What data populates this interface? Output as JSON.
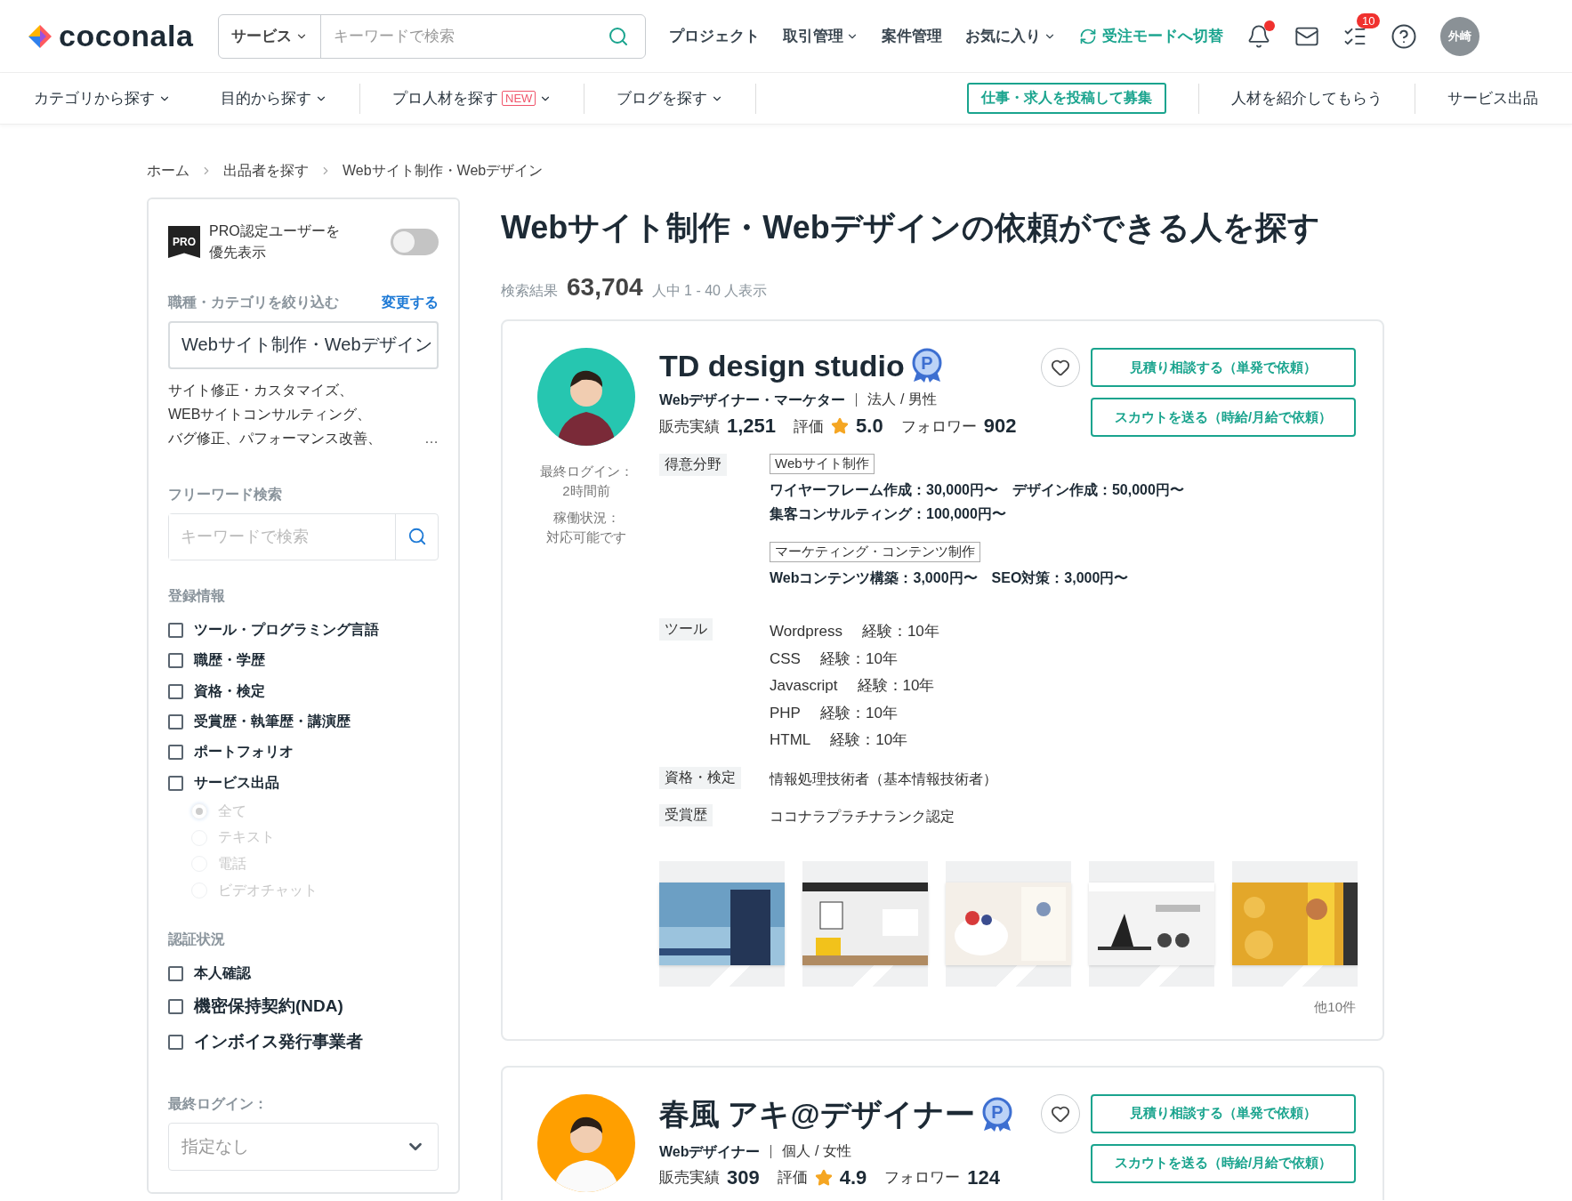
{
  "header": {
    "logo": "coconala",
    "search": {
      "category": "サービス",
      "placeholder": "キーワードで検索"
    },
    "nav": [
      {
        "label": "プロジェクト",
        "dropdown": false
      },
      {
        "label": "取引管理",
        "dropdown": true
      },
      {
        "label": "案件管理",
        "dropdown": false
      },
      {
        "label": "お気に入り",
        "dropdown": true
      }
    ],
    "mode_switch": "受注モードへ切替",
    "notification_dot": true,
    "todo_badge": "10",
    "avatar": "外崎"
  },
  "subnav": [
    {
      "label": "カテゴリから探す",
      "kind": "menu",
      "dropdown": true
    },
    {
      "label": "目的から探す",
      "kind": "menu",
      "dropdown": true
    },
    {
      "label": "プロ人材を探す",
      "kind": "menu",
      "dropdown": true,
      "badge": "NEW"
    },
    {
      "label": "ブログを探す",
      "kind": "menu",
      "dropdown": true
    },
    {
      "label": "仕事・求人を投稿して募集",
      "kind": "outlined",
      "dropdown": false
    },
    {
      "label": "人材を紹介してもらう",
      "kind": "menu",
      "dropdown": false
    },
    {
      "label": "サービス出品",
      "kind": "menu",
      "dropdown": false
    }
  ],
  "breadcrumb": [
    "ホーム",
    "出品者を探す",
    "Webサイト制作・Webデザイン"
  ],
  "sidebar": {
    "pro_toggle": {
      "badge": "PRO",
      "label": "PRO認定ユーザーを優先表示",
      "on": false
    },
    "category": {
      "heading": "職種・カテゴリを絞り込む",
      "change_link": "変更する",
      "value": "Webサイト制作・Webデザイン",
      "subcategories": [
        "サイト修正・カスタマイズ、",
        "WEBサイトコンサルティング、",
        "バグ修正、パフォーマンス改善、"
      ],
      "more": "…"
    },
    "freeword": {
      "heading": "フリーワード検索",
      "placeholder": "キーワードで検索"
    },
    "registration": {
      "heading": "登録情報",
      "options": [
        {
          "label": "ツール・プログラミング言語",
          "checked": false
        },
        {
          "label": "職歴・学歴",
          "checked": false
        },
        {
          "label": "資格・検定",
          "checked": false
        },
        {
          "label": "受賞歴・執筆歴・講演歴",
          "checked": false
        },
        {
          "label": "ポートフォリオ",
          "checked": false
        },
        {
          "label": "サービス出品",
          "checked": false
        }
      ],
      "service_types": {
        "disabled": true,
        "options": [
          {
            "label": "全て",
            "selected": true
          },
          {
            "label": "テキスト",
            "selected": false
          },
          {
            "label": "電話",
            "selected": false
          },
          {
            "label": "ビデオチャット",
            "selected": false
          }
        ]
      }
    },
    "verification": {
      "heading": "認証状況",
      "options": [
        {
          "label": "本人確認",
          "checked": false
        },
        {
          "label": "機密保持契約(NDA)",
          "checked": false
        },
        {
          "label": "インボイス発行事業者",
          "checked": false
        }
      ]
    },
    "last_login": {
      "heading": "最終ログイン：",
      "value": "指定なし"
    }
  },
  "main": {
    "title": "Webサイト制作・Webデザインの依頼ができる人を探す",
    "results": {
      "label": "検索結果",
      "count": "63,704",
      "range": "人中 1 - 40 人表示"
    },
    "sellers": [
      {
        "name": "TD design studio",
        "pro_mark": "P",
        "role": "Webデザイナー・マーケター",
        "entity": "法人 / 男性",
        "sales_label": "販売実績",
        "sales": "1,251",
        "rating_label": "評価",
        "rating": "5.0",
        "followers_label": "フォロワー",
        "followers": "902",
        "favorited": false,
        "buttons": [
          "見積り相談する（単発で依頼）",
          "スカウトを送る（時給/月給で依頼）"
        ],
        "last_login_label": "最終ログイン：",
        "last_login": "2時間前",
        "status_label": "稼働状況：",
        "status": "対応可能です",
        "details": [
          {
            "kind": "specialties",
            "label": "得意分野",
            "groups": [
              {
                "tag": "Webサイト制作",
                "items": [
                  "ワイヤーフレーム作成：30,000円〜",
                  "デザイン作成：50,000円〜",
                  "集客コンサルティング：100,000円〜"
                ]
              },
              {
                "tag": "マーケティング・コンテンツ制作",
                "items": [
                  "Webコンテンツ構築：3,000円〜",
                  "SEO対策：3,000円〜"
                ]
              }
            ]
          },
          {
            "kind": "tools",
            "label": "ツール",
            "items": [
              {
                "name": "Wordpress",
                "experience": "経験：10年"
              },
              {
                "name": "CSS",
                "experience": "経験：10年"
              },
              {
                "name": "Javascript",
                "experience": "経験：10年"
              },
              {
                "name": "PHP",
                "experience": "経験：10年"
              },
              {
                "name": "HTML",
                "experience": "経験：10年"
              }
            ]
          },
          {
            "kind": "text",
            "label": "資格・検定",
            "text": "情報処理技術者（基本情報技術者）"
          },
          {
            "kind": "text",
            "label": "受賞歴",
            "text": "ココナラプラチナランク認定"
          }
        ],
        "portfolio": [
          {
            "kind": "picture"
          },
          {
            "kind": "picture"
          },
          {
            "kind": "picture"
          },
          {
            "kind": "picture"
          },
          {
            "kind": "picture"
          }
        ],
        "portfolio_more": "他10件"
      },
      {
        "name": "春風 アキ@デザイナー",
        "pro_mark": "P",
        "role": "Webデザイナー",
        "entity": "個人 / 女性",
        "sales_label": "販売実績",
        "sales": "309",
        "rating_label": "評価",
        "rating": "4.9",
        "followers_label": "フォロワー",
        "followers": "124",
        "favorited": false,
        "buttons": [
          "見積り相談する（単発で依頼）",
          "スカウトを送る（時給/月給で依頼）"
        ]
      }
    ]
  }
}
